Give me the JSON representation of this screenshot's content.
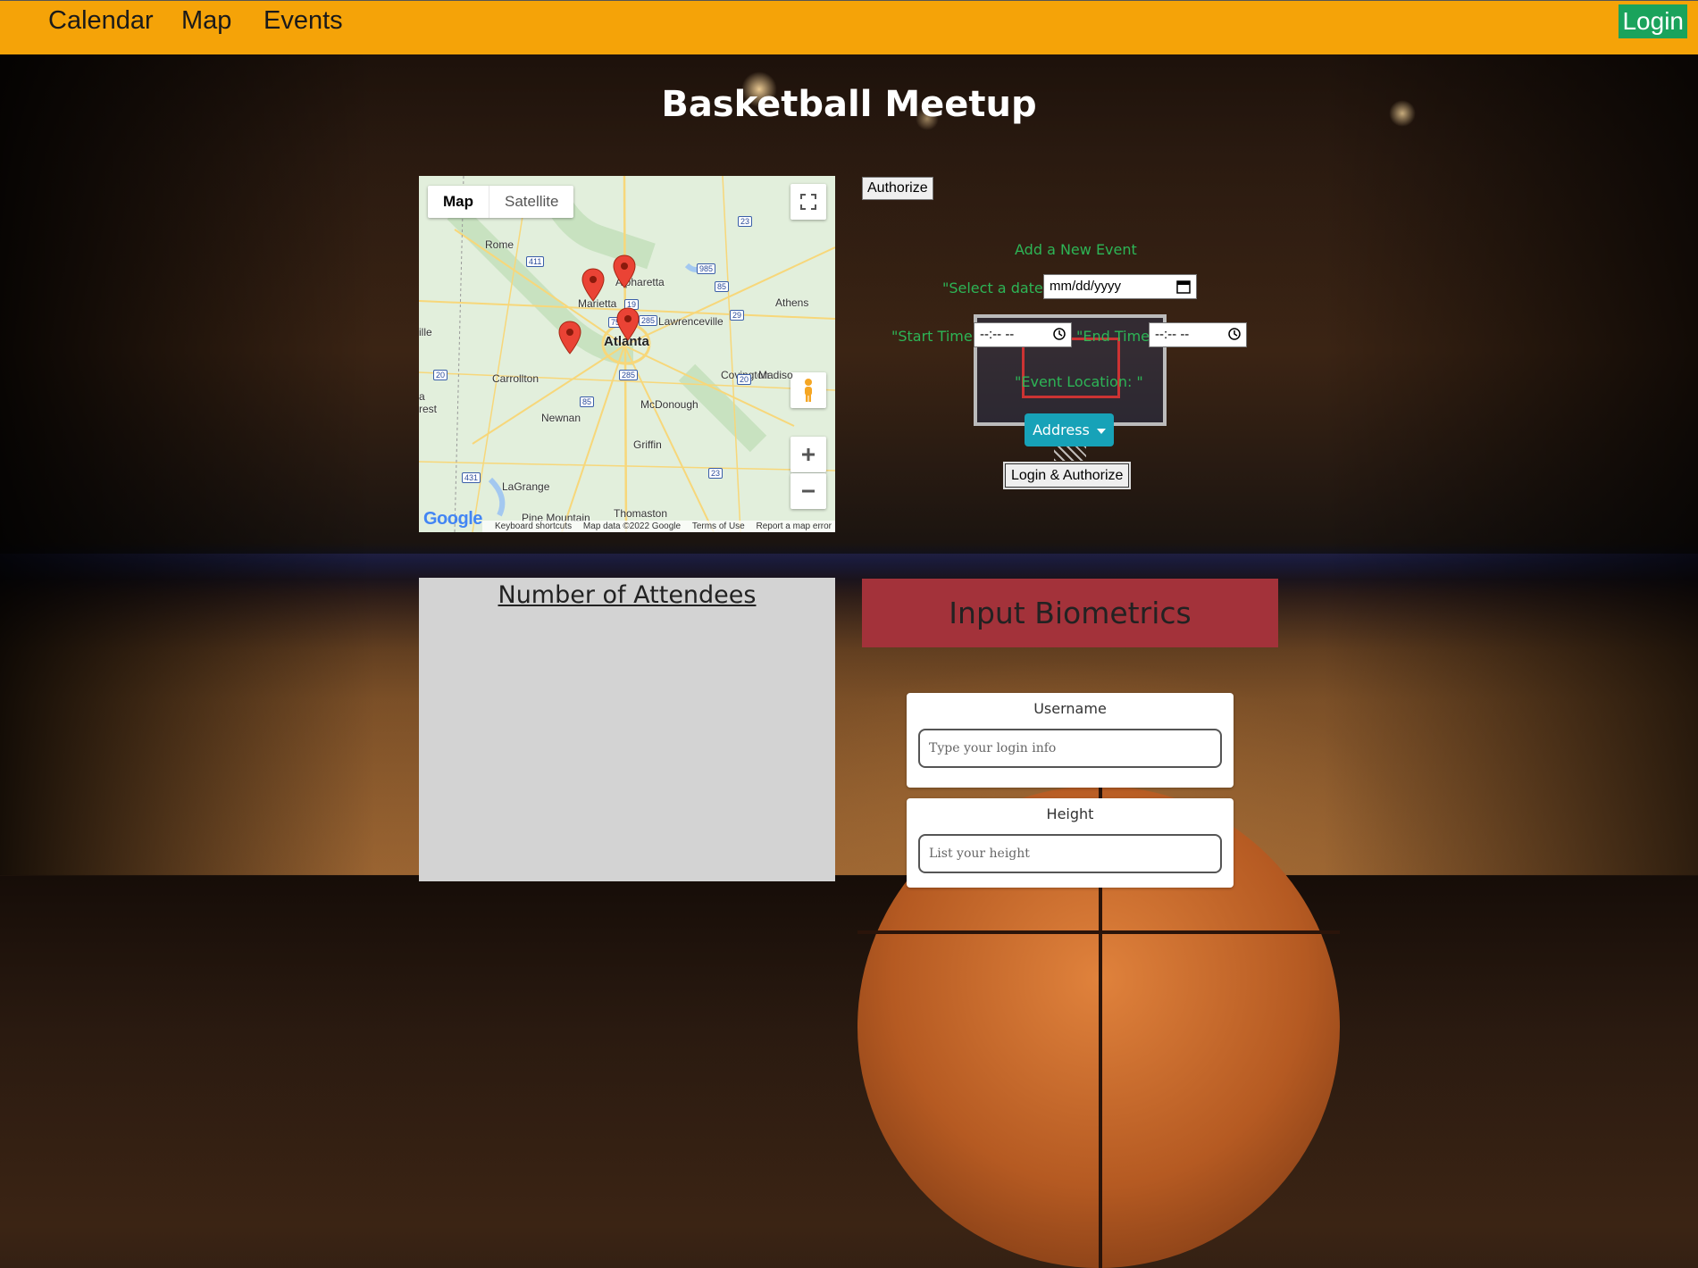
{
  "nav": {
    "links": [
      "Calendar",
      "Map",
      "Events"
    ],
    "login_label": "Login"
  },
  "page_title": "Basketball Meetup",
  "map": {
    "type_buttons": [
      "Map",
      "Satellite"
    ],
    "places": {
      "rome": "Rome",
      "alpharetta": "Alpharetta",
      "marietta": "Marietta",
      "lawrenceville": "Lawrenceville",
      "athens": "Athens",
      "atlanta": "Atlanta",
      "carrollton": "Carrollton",
      "covington": "Covington",
      "madison": "Madiso",
      "forest": "rest",
      "newnan": "Newnan",
      "mcdonough": "McDonough",
      "griffin": "Griffin",
      "lagrange": "LaGrange",
      "pine_mountain": "Pine Mountain",
      "thomaston": "Thomaston",
      "ille": "ille",
      "a": "a"
    },
    "shields": [
      "23",
      "411",
      "985",
      "85",
      "29",
      "75",
      "285",
      "20",
      "20",
      "285",
      "85",
      "23",
      "431",
      "19"
    ],
    "google_logo": "Google",
    "footer": [
      "Keyboard shortcuts",
      "Map data ©2022 Google",
      "Terms of Use",
      "Report a map error"
    ],
    "icons": [
      "fullscreen-icon",
      "pegman-icon",
      "zoom-in-icon",
      "zoom-out-icon",
      "map-pin-icon"
    ]
  },
  "event_form": {
    "authorize_label": "Authorize",
    "heading": "Add a New Event",
    "date_label": "\"Select a date: \"",
    "date_placeholder": "mm/dd/yyyy",
    "start_label": "\"Start Time \"",
    "start_placeholder": "--:-- --",
    "end_label": "\"End Time\"",
    "end_placeholder": "--:-- --",
    "location_label": "\"Event Location: \"",
    "address_button": "Address",
    "login_authorize_label": "Login & Authorize",
    "accent_color": "#2db556"
  },
  "attendees": {
    "title": "Number of Attendees"
  },
  "biometrics": {
    "header": "Input Biometrics",
    "fields": [
      {
        "label": "Username",
        "placeholder": "Type your login info"
      },
      {
        "label": "Height",
        "placeholder": "List your height"
      }
    ]
  },
  "colors": {
    "navbar": "#f5a308",
    "login_button": "#1aa35c",
    "address_button": "#17a2b8",
    "biometrics_header": "#a3323a",
    "attendees_panel": "#d3d3d3"
  }
}
